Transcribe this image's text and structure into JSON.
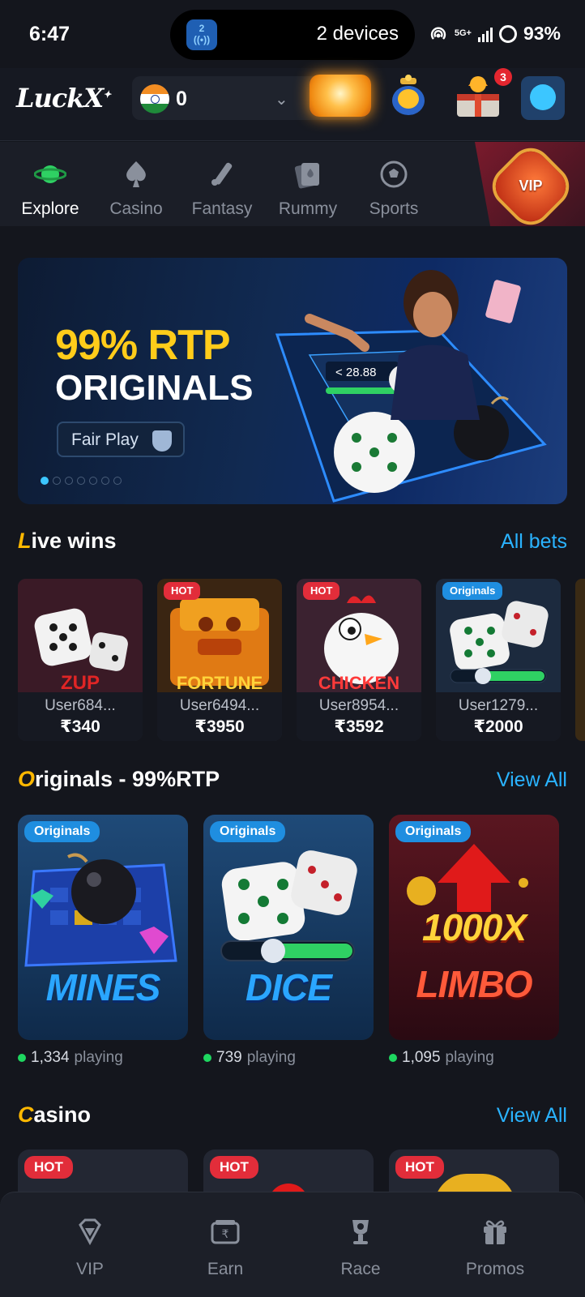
{
  "status_bar": {
    "time": "6:47",
    "island_badge": "2",
    "island_text": "2 devices",
    "network": "5G+",
    "battery": "93%"
  },
  "header": {
    "logo": "LuckX",
    "balance": "0",
    "notification_count": "3"
  },
  "categories": [
    {
      "label": "Explore",
      "icon": "planet-icon",
      "active": true
    },
    {
      "label": "Casino",
      "icon": "spade-icon",
      "active": false
    },
    {
      "label": "Fantasy",
      "icon": "cricket-bat-icon",
      "active": false
    },
    {
      "label": "Rummy",
      "icon": "cards-icon",
      "active": false
    },
    {
      "label": "Sports",
      "icon": "football-icon",
      "active": false
    }
  ],
  "vip_promo": {
    "label": "VIP"
  },
  "banner": {
    "headline": "99% RTP",
    "subheadline": "ORIGINALS",
    "badge": "Fair Play",
    "slide_count": 7,
    "active_slide": 0,
    "art_text": "< 28.88"
  },
  "live_wins": {
    "title_cap": "L",
    "title_rest": "ive wins",
    "link": "All bets",
    "items": [
      {
        "tag": "",
        "game": "ZUP",
        "user": "User684...",
        "amount": "₹340"
      },
      {
        "tag": "HOT",
        "game": "FORTUNE",
        "user": "User6494...",
        "amount": "₹3950"
      },
      {
        "tag": "HOT",
        "game": "CHICKEN",
        "user": "User8954...",
        "amount": "₹3592"
      },
      {
        "tag": "Originals",
        "game": "",
        "user": "User1279...",
        "amount": "₹2000"
      }
    ]
  },
  "originals": {
    "title_cap": "O",
    "title_rest": "riginals - 99%RTP",
    "link": "View All",
    "items": [
      {
        "tag": "Originals",
        "title": "MINES",
        "players": "1,334",
        "playing_label": "playing"
      },
      {
        "tag": "Originals",
        "title": "DICE",
        "players": "739",
        "playing_label": "playing"
      },
      {
        "tag": "Originals",
        "title_top": "1000X",
        "title": "LIMBO",
        "players": "1,095",
        "playing_label": "playing"
      }
    ]
  },
  "casino": {
    "title_cap": "C",
    "title_rest": "asino",
    "link": "View All",
    "items": [
      {
        "tag": "HOT"
      },
      {
        "tag": "HOT"
      },
      {
        "tag": "HOT"
      }
    ]
  },
  "bottom_nav": [
    {
      "label": "VIP",
      "icon": "diamond-icon"
    },
    {
      "label": "Earn",
      "icon": "wallet-icon"
    },
    {
      "label": "Race",
      "icon": "trophy-icon"
    },
    {
      "label": "Promos",
      "icon": "gift-icon"
    }
  ],
  "colors": {
    "background": "#14161d",
    "accent_blue": "#2ab3ff",
    "accent_gold": "#ffb800",
    "hot_red": "#e22d3a",
    "originals_blue": "#1f8ee0",
    "online_green": "#1ed760"
  }
}
